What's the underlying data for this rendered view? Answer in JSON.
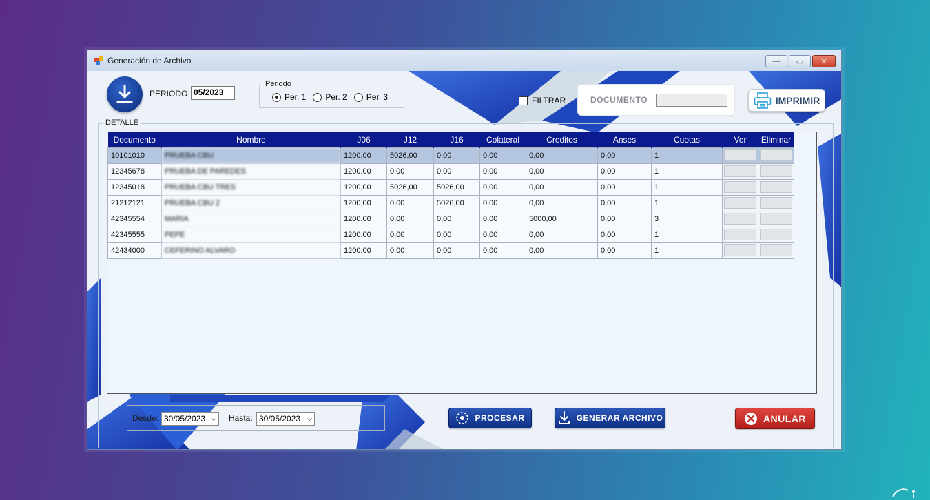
{
  "window": {
    "title": "Generación de Archivo",
    "controls": {
      "minimize": "—",
      "maximize": "▭",
      "close": "✕"
    }
  },
  "header": {
    "periodo_label": "PERIODO",
    "periodo_value": "05/2023",
    "periodo_group_title": "Periodo",
    "periodo_options": [
      {
        "label": "Per. 1",
        "selected": true
      },
      {
        "label": "Per. 2",
        "selected": false
      },
      {
        "label": "Per. 3",
        "selected": false
      }
    ],
    "filtrar_label": "FILTRAR",
    "filtrar_checked": false,
    "documento_label": "DOCUMENTO",
    "documento_value": "",
    "imprimir_label": "IMPRIMIR"
  },
  "detalle": {
    "title": "DETALLE",
    "columns": [
      "Documento",
      "Nombre",
      "J06",
      "J12",
      "J16",
      "Colateral",
      "Creditos",
      "Anses",
      "Cuotas",
      "Ver",
      "Eliminar"
    ],
    "rows": [
      {
        "documento": "10101010",
        "nombre": "PRUEBA CBU",
        "j06": "1200,00",
        "j12": "5026,00",
        "j16": "0,00",
        "colateral": "0,00",
        "creditos": "0,00",
        "anses": "0,00",
        "cuotas": "1",
        "selected": true
      },
      {
        "documento": "12345678",
        "nombre": "PRUEBA DE PAREDES",
        "j06": "1200,00",
        "j12": "0,00",
        "j16": "0,00",
        "colateral": "0,00",
        "creditos": "0,00",
        "anses": "0,00",
        "cuotas": "1",
        "selected": false
      },
      {
        "documento": "12345018",
        "nombre": "PRUEBA CBU TRES",
        "j06": "1200,00",
        "j12": "5026,00",
        "j16": "5026,00",
        "colateral": "0,00",
        "creditos": "0,00",
        "anses": "0,00",
        "cuotas": "1",
        "selected": false
      },
      {
        "documento": "21212121",
        "nombre": "PRUEBA CBU 2",
        "j06": "1200,00",
        "j12": "0,00",
        "j16": "5026,00",
        "colateral": "0,00",
        "creditos": "0,00",
        "anses": "0,00",
        "cuotas": "1",
        "selected": false
      },
      {
        "documento": "42345554",
        "nombre": "MARIA",
        "j06": "1200,00",
        "j12": "0,00",
        "j16": "0,00",
        "colateral": "0,00",
        "creditos": "5000,00",
        "anses": "0,00",
        "cuotas": "3",
        "selected": false
      },
      {
        "documento": "42345555",
        "nombre": "PEPE",
        "j06": "1200,00",
        "j12": "0,00",
        "j16": "0,00",
        "colateral": "0,00",
        "creditos": "0,00",
        "anses": "0,00",
        "cuotas": "1",
        "selected": false
      },
      {
        "documento": "42434000",
        "nombre": "CEFERINO ALVARO",
        "j06": "1200,00",
        "j12": "0,00",
        "j16": "0,00",
        "colateral": "0,00",
        "creditos": "0,00",
        "anses": "0,00",
        "cuotas": "1",
        "selected": false
      }
    ]
  },
  "footer": {
    "desde_label": "Desde:",
    "desde_value": "30/05/2023",
    "hasta_label": "Hasta:",
    "hasta_value": "30/05/2023",
    "procesar_label": "PROCESAR",
    "generar_label": "GENERAR ARCHIVO",
    "anular_label": "ANULAR"
  },
  "colors": {
    "grid_header": "#0b1a8f",
    "accent_blue": "#1f4fc4",
    "anular_red": "#c42a24"
  }
}
